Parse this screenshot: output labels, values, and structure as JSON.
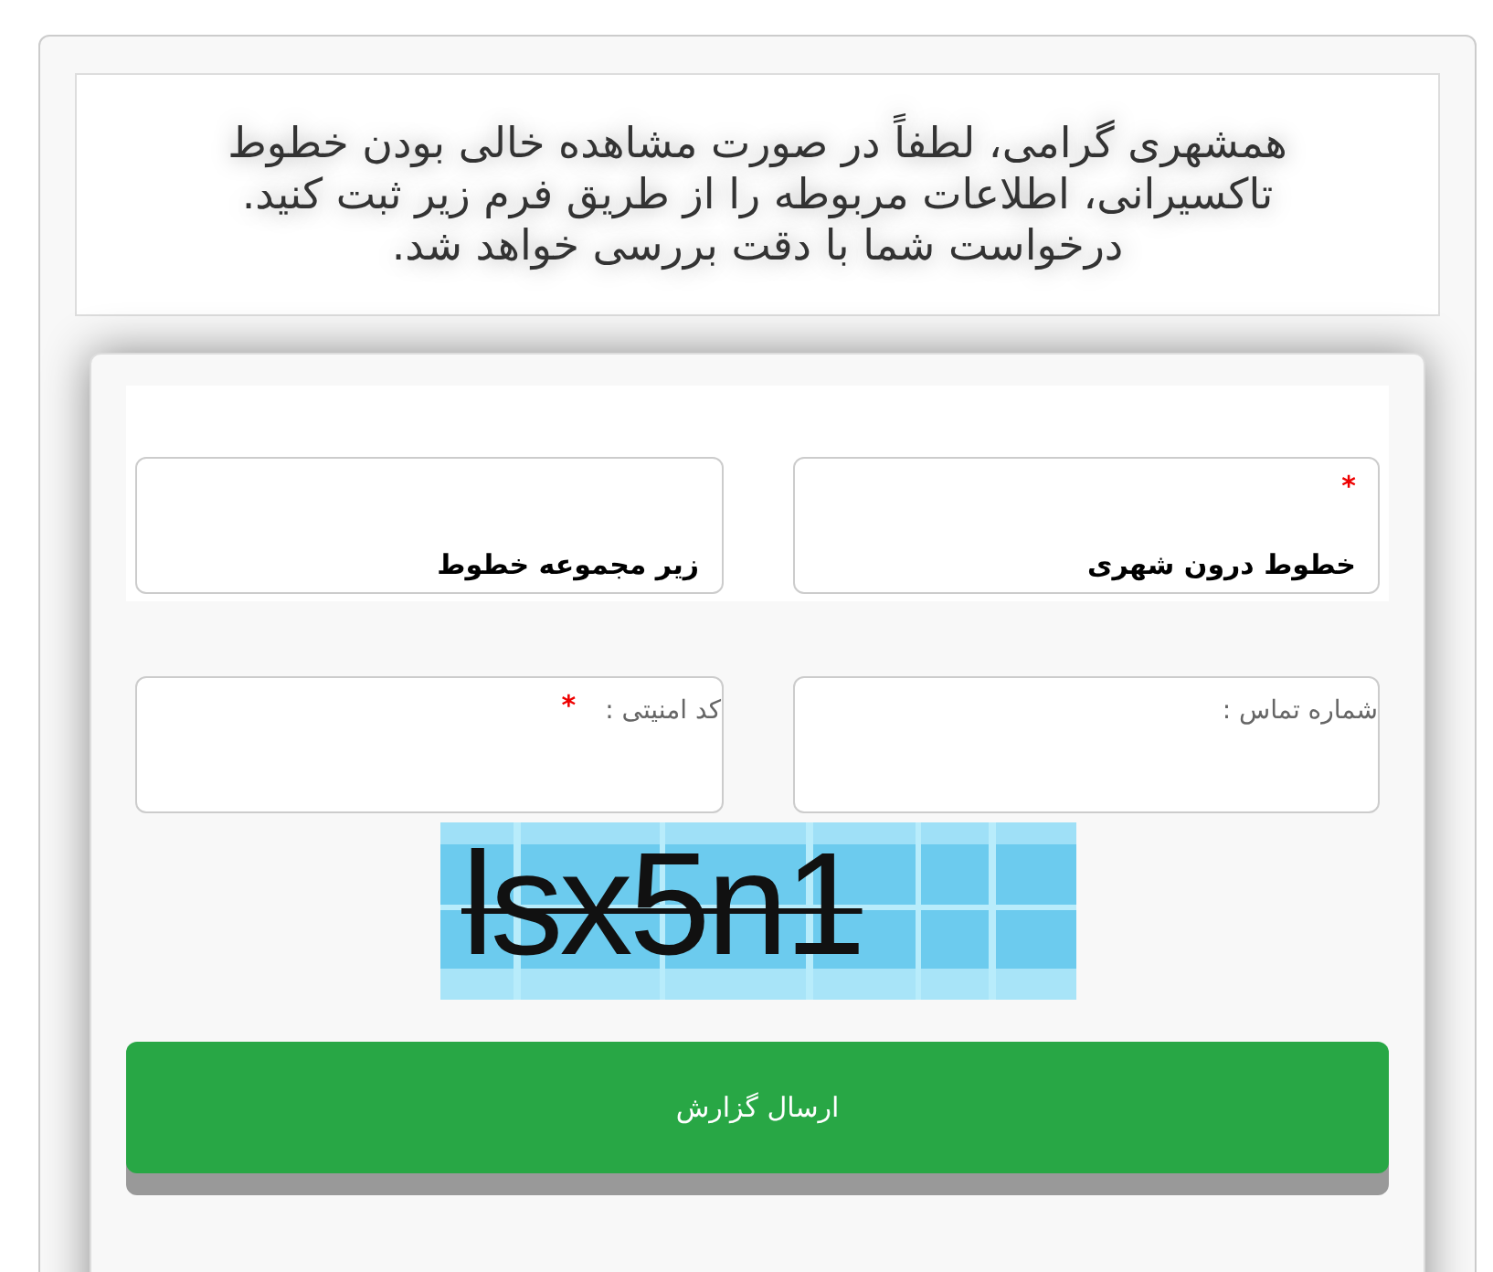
{
  "intro": "همشهری گرامی، لطفاً در صورت مشاهده خالی بودن خطوط تاکسیرانی، اطلاعات مربوطه را از طریق فرم زیر ثبت کنید. درخواست شما با دقت بررسی خواهد شد.",
  "required_mark": "*",
  "fields": [
    {
      "kind": "select",
      "value": "خطوط درون شهری",
      "required": true
    },
    {
      "kind": "select",
      "value": "زیر مجموعه خطوط",
      "required": false
    },
    {
      "kind": "input",
      "label": "شماره تماس :",
      "required": false
    },
    {
      "kind": "input",
      "label": "کد امنیتی :",
      "required": true
    }
  ],
  "captcha": {
    "text": "lsx5n1"
  },
  "submit": "ارسال گزارش"
}
